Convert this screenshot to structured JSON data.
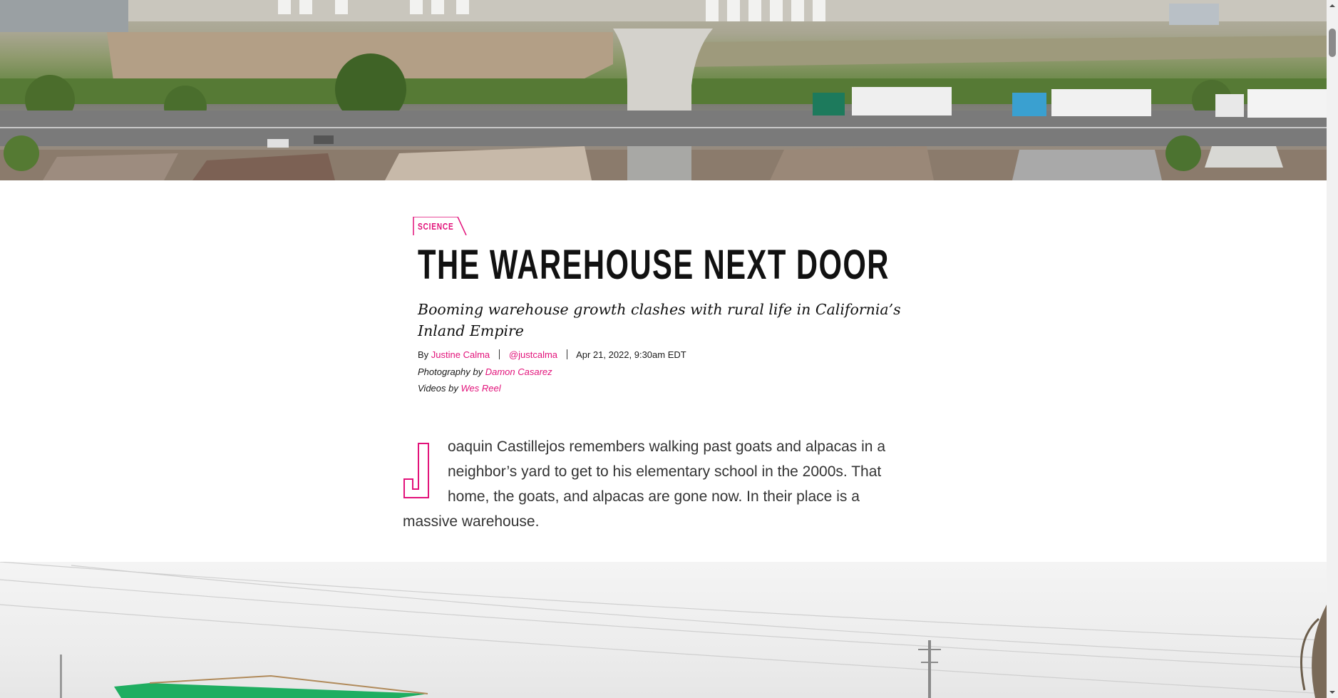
{
  "article": {
    "section": "SCIENCE",
    "headline": "THE WAREHOUSE NEXT DOOR",
    "dek": "Booming warehouse growth clashes with rural life in California’s Inland Empire",
    "byline": {
      "prefix": "By",
      "author": "Justine Calma",
      "handle": "@justcalma",
      "date": "Apr 21, 2022, 9:30am EDT"
    },
    "photo_credit": {
      "prefix": "Photography by",
      "name": "Damon Casarez"
    },
    "video_credit": {
      "prefix": "Videos by",
      "name": "Wes Reel"
    },
    "body": {
      "drop_cap": "J",
      "text": "oaquin Castillejos remembers walking past goats and alpacas in a neighbor’s yard to get to his elementary school in the 2000s. That home, the goats, and alpacas are gone now. In their place is a massive warehouse."
    }
  },
  "colors": {
    "accent": "#e2127a",
    "text": "#111111",
    "body_text": "#333333"
  },
  "icons": {
    "scroll_up": "chevron-up-icon",
    "scroll_down": "chevron-down-icon"
  }
}
